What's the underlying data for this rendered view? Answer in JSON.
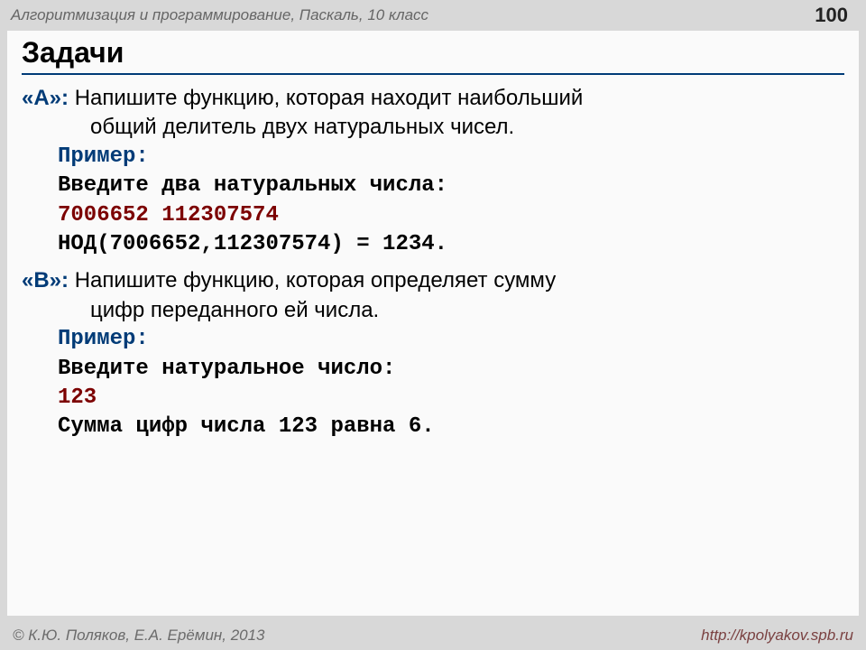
{
  "header": {
    "course": "Алгоритмизация и программирование, Паскаль, 10 класс",
    "page_number": "100"
  },
  "title": "Задачи",
  "tasks": {
    "a": {
      "label": "«A»:",
      "text_line1": " Напишите функцию, которая находит наибольший",
      "text_line2": "общий делитель двух натуральных чисел.",
      "example_label": "Пример:",
      "io1": "Введите два натуральных числа:",
      "io2": "7006652 112307574",
      "io3": "НОД(7006652,112307574) = 1234."
    },
    "b": {
      "label": "«B»:",
      "text_line1": " Напишите функцию, которая определяет сумму",
      "text_line2": "цифр переданного ей числа.",
      "example_label": "Пример:",
      "io1": "Введите натуральное число:",
      "io2": "123",
      "io3": "Сумма цифр числа 123 равна 6."
    }
  },
  "footer": {
    "authors": "© К.Ю. Поляков, Е.А. Ерёмин, 2013",
    "url": "http://kpolyakov.spb.ru"
  }
}
